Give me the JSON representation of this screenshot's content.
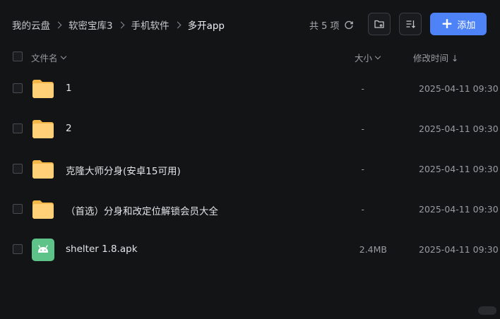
{
  "breadcrumb": [
    {
      "label": "我的云盘"
    },
    {
      "label": "软密宝库3"
    },
    {
      "label": "手机软件"
    },
    {
      "label": "多开app"
    }
  ],
  "toolbar": {
    "count_text": "共 5 项",
    "new_folder_icon": "new-folder-icon",
    "sort_icon": "sort-icon",
    "add_label": "添加",
    "accent_color": "#4e83f7"
  },
  "columns": {
    "name": "文件名",
    "size": "大小",
    "modified": "修改时间 ↓"
  },
  "files": [
    {
      "name": "1",
      "size": "-",
      "modified": "2025-04-11 09:30",
      "type": "folder"
    },
    {
      "name": "2",
      "size": "-",
      "modified": "2025-04-11 09:30",
      "type": "folder"
    },
    {
      "name": "克隆大师分身(安卓15可用)",
      "size": "-",
      "modified": "2025-04-11 09:30",
      "type": "folder"
    },
    {
      "name": "（首选）分身和改定位解锁会员大全",
      "size": "-",
      "modified": "2025-04-11 09:30",
      "type": "folder"
    },
    {
      "name": "shelter 1.8.apk",
      "size": "2.4MB",
      "modified": "2025-04-11 09:30",
      "type": "apk"
    }
  ]
}
